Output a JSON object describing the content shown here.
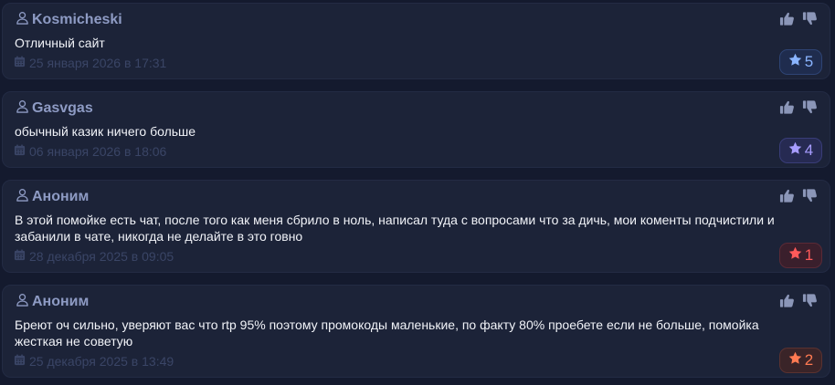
{
  "reviews": [
    {
      "author": "Kosmicheski",
      "text": "Отличный сайт",
      "date": "25 января 2026 в 17:31",
      "rating": "5",
      "rating_color": "#8ab4ff",
      "rating_bg": "#1f2c4e",
      "rating_border": "#2e4474"
    },
    {
      "author": "Gasvgas",
      "text": "обычный казик ничего больше",
      "date": "06 января 2026 в 18:06",
      "rating": "4",
      "rating_color": "#a79cff",
      "rating_bg": "#262a52",
      "rating_border": "#393d78"
    },
    {
      "author": "Аноним",
      "text": "В этой помойке есть чат, после того как меня сбрило в ноль, написал туда с вопросами что за дичь, мои коменты подчистили и забанили в чате, никогда не делайте в это говно",
      "date": "28 декабря 2025 в 09:05",
      "rating": "1",
      "rating_color": "#ff5a5a",
      "rating_bg": "#3a1f2c",
      "rating_border": "#5a2a36"
    },
    {
      "author": "Аноним",
      "text": "Бреют оч сильно, уверяют вас что rtp 95% поэтому промокоды маленькие, по факту 80% проебете если не больше, помойка жесткая не советую",
      "date": "25 декабря 2025 в 13:49",
      "rating": "2",
      "rating_color": "#ff7a52",
      "rating_bg": "#3a2428",
      "rating_border": "#5a3230"
    }
  ],
  "icons": {
    "author": "user-icon",
    "date": "calendar-icon",
    "like": "thumbs-up-icon",
    "dislike": "thumbs-down-icon",
    "rating": "star-icon"
  }
}
